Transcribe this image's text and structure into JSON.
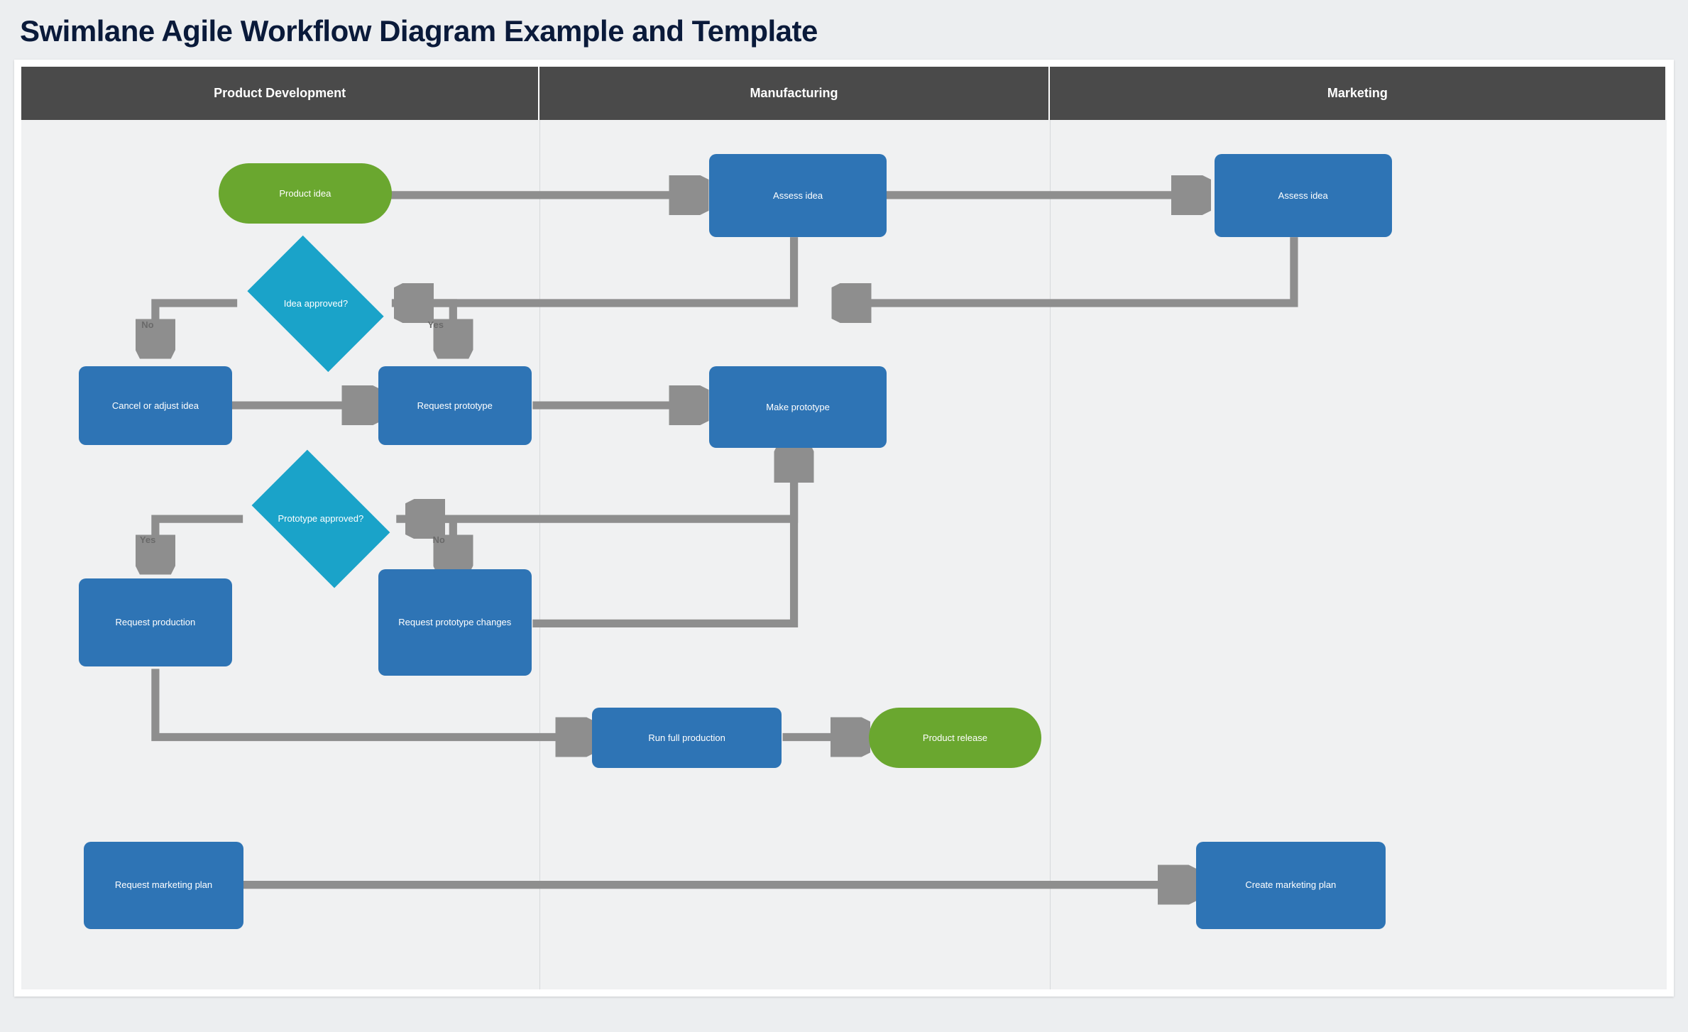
{
  "title": "Swimlane Agile Workflow Diagram Example and Template",
  "lanes": [
    {
      "name": "Product Development"
    },
    {
      "name": "Manufacturing"
    },
    {
      "name": "Marketing"
    }
  ],
  "nodes": {
    "product_idea": {
      "text": "Product idea",
      "type": "start"
    },
    "assess_idea_mfg": {
      "text": "Assess idea",
      "type": "process"
    },
    "assess_idea_mkt": {
      "text": "Assess idea",
      "type": "process"
    },
    "idea_approved": {
      "text": "Idea approved?",
      "type": "decision"
    },
    "cancel_adjust": {
      "text": "Cancel or adjust idea",
      "type": "process"
    },
    "request_prototype": {
      "text": "Request prototype",
      "type": "process"
    },
    "make_prototype": {
      "text": "Make prototype",
      "type": "process"
    },
    "prototype_approved": {
      "text": "Prototype approved?",
      "type": "decision"
    },
    "request_production": {
      "text": "Request production",
      "type": "process"
    },
    "request_proto_chg": {
      "text": "Request prototype changes",
      "type": "process"
    },
    "run_full_production": {
      "text": "Run full production",
      "type": "process"
    },
    "product_release": {
      "text": "Product release",
      "type": "end"
    },
    "request_mkt_plan": {
      "text": "Request marketing plan",
      "type": "process"
    },
    "create_mkt_plan": {
      "text": "Create marketing plan",
      "type": "process"
    }
  },
  "edge_labels": {
    "idea_no": "No",
    "idea_yes": "Yes",
    "proto_yes": "Yes",
    "proto_no": "No"
  },
  "colors": {
    "lane_header": "#4a4a4a",
    "process": "#2e74b5",
    "decision": "#1aa3c9",
    "terminator": "#6aa72f",
    "connector": "#8e8e8e"
  }
}
